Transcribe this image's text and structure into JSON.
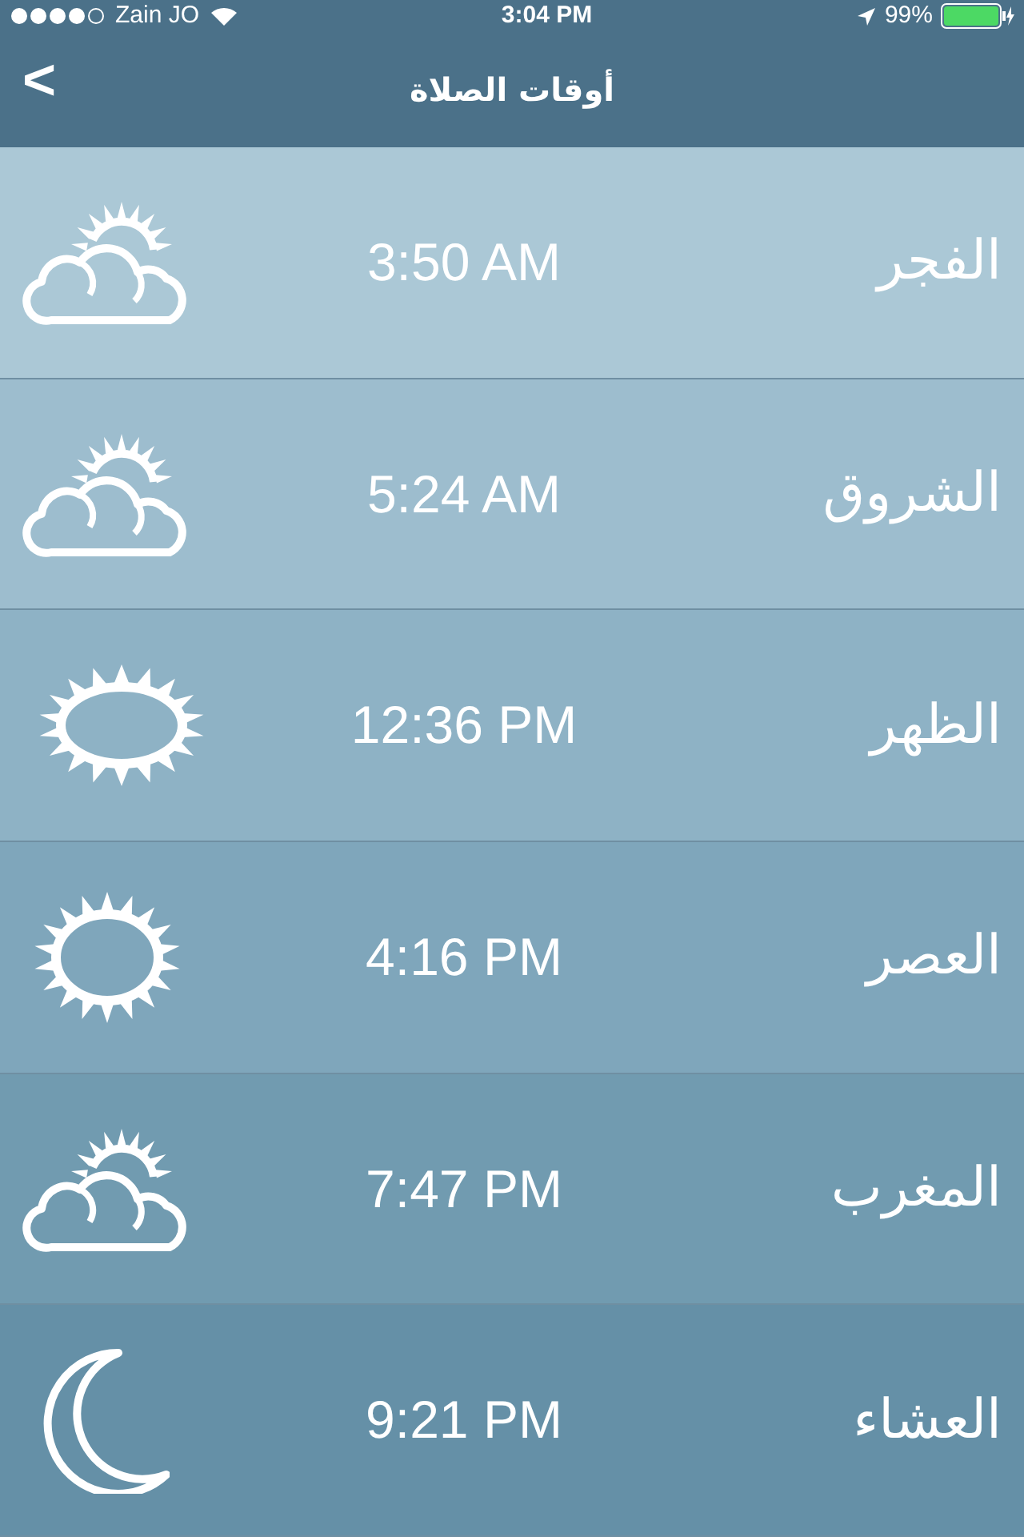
{
  "status_bar": {
    "carrier": "Zain JO",
    "time": "3:04 PM",
    "battery": "99%"
  },
  "nav_bar": {
    "back": "<",
    "title": "أوقات الصلاة"
  },
  "prayers": [
    {
      "name": "الفجر",
      "time": "3:50 AM",
      "kind": "cloudy"
    },
    {
      "name": "الشروق",
      "time": "5:24 AM",
      "kind": "cloudy"
    },
    {
      "name": "الظهر",
      "time": "12:36 PM",
      "kind": "noon"
    },
    {
      "name": "العصر",
      "time": "4:16 PM",
      "kind": "sunny"
    },
    {
      "name": "المغرب",
      "time": "7:47 PM",
      "kind": "cloudy"
    },
    {
      "name": "العشاء",
      "time": "9:21 PM",
      "kind": "night"
    }
  ]
}
